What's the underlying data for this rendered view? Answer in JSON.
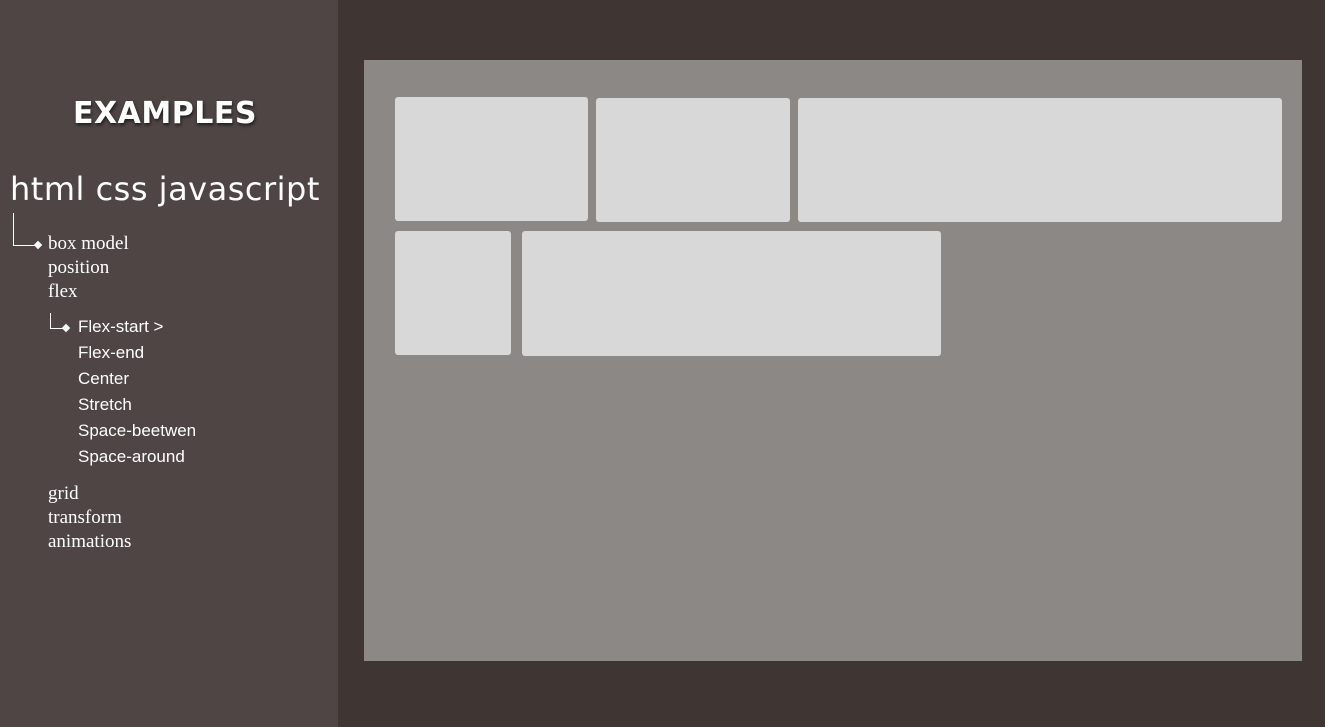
{
  "sidebar": {
    "title": "EXAMPLES",
    "tech_line": "html css javascript",
    "nav": [
      {
        "label": "box model"
      },
      {
        "label": "position"
      },
      {
        "label": "flex"
      }
    ],
    "flex_sub": [
      {
        "label": "Flex-start >"
      },
      {
        "label": "Flex-end"
      },
      {
        "label": "Center"
      },
      {
        "label": "Stretch"
      },
      {
        "label": "Space-beetwen"
      },
      {
        "label": "Space-around"
      }
    ],
    "nav_after": [
      {
        "label": "grid"
      },
      {
        "label": "transform"
      },
      {
        "label": "animations"
      }
    ]
  },
  "colors": {
    "background": "#3f3634",
    "sidebar": "#4e4544",
    "stage": "#8c8886",
    "box": "#d8d8d8"
  }
}
